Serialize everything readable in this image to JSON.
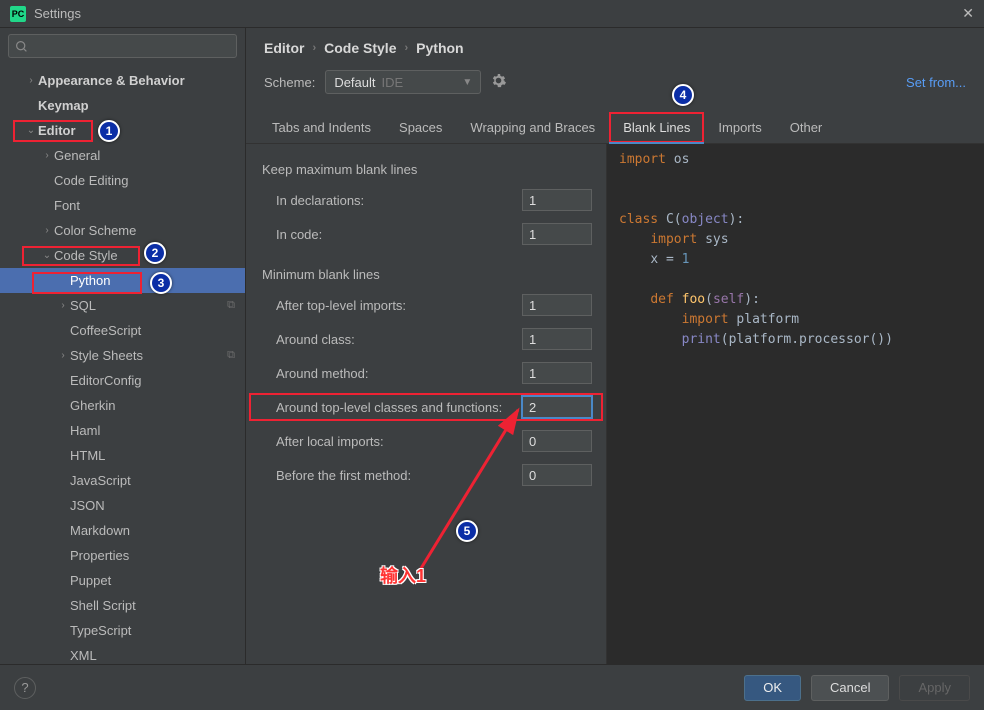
{
  "titlebar": {
    "title": "Settings"
  },
  "sidebar": {
    "search_placeholder": "",
    "items": [
      {
        "label": "Appearance & Behavior",
        "indent": 24,
        "arrow": ">",
        "bold": true
      },
      {
        "label": "Keymap",
        "indent": 24,
        "arrow": "",
        "bold": true
      },
      {
        "label": "Editor",
        "indent": 24,
        "arrow": "v",
        "bold": true
      },
      {
        "label": "General",
        "indent": 40,
        "arrow": ">"
      },
      {
        "label": "Code Editing",
        "indent": 40,
        "arrow": ""
      },
      {
        "label": "Font",
        "indent": 40,
        "arrow": ""
      },
      {
        "label": "Color Scheme",
        "indent": 40,
        "arrow": ">"
      },
      {
        "label": "Code Style",
        "indent": 40,
        "arrow": "v"
      },
      {
        "label": "Python",
        "indent": 56,
        "arrow": "",
        "selected": true
      },
      {
        "label": "SQL",
        "indent": 56,
        "arrow": ">",
        "copy": true
      },
      {
        "label": "CoffeeScript",
        "indent": 56,
        "arrow": ""
      },
      {
        "label": "Style Sheets",
        "indent": 56,
        "arrow": ">",
        "copy": true
      },
      {
        "label": "EditorConfig",
        "indent": 56,
        "arrow": ""
      },
      {
        "label": "Gherkin",
        "indent": 56,
        "arrow": ""
      },
      {
        "label": "Haml",
        "indent": 56,
        "arrow": ""
      },
      {
        "label": "HTML",
        "indent": 56,
        "arrow": ""
      },
      {
        "label": "JavaScript",
        "indent": 56,
        "arrow": ""
      },
      {
        "label": "JSON",
        "indent": 56,
        "arrow": ""
      },
      {
        "label": "Markdown",
        "indent": 56,
        "arrow": ""
      },
      {
        "label": "Properties",
        "indent": 56,
        "arrow": ""
      },
      {
        "label": "Puppet",
        "indent": 56,
        "arrow": ""
      },
      {
        "label": "Shell Script",
        "indent": 56,
        "arrow": ""
      },
      {
        "label": "TypeScript",
        "indent": 56,
        "arrow": ""
      },
      {
        "label": "XML",
        "indent": 56,
        "arrow": ""
      }
    ]
  },
  "breadcrumb": {
    "a": "Editor",
    "b": "Code Style",
    "c": "Python"
  },
  "scheme": {
    "label": "Scheme:",
    "value": "Default",
    "ide": "IDE",
    "set_from": "Set from..."
  },
  "tabs": [
    "Tabs and Indents",
    "Spaces",
    "Wrapping and Braces",
    "Blank Lines",
    "Imports",
    "Other"
  ],
  "form": {
    "sec1": "Keep maximum blank lines",
    "r1": {
      "label": "In declarations:",
      "val": "1"
    },
    "r2": {
      "label": "In code:",
      "val": "1"
    },
    "sec2": "Minimum blank lines",
    "r3": {
      "label": "After top-level imports:",
      "val": "1"
    },
    "r4": {
      "label": "Around class:",
      "val": "1"
    },
    "r5": {
      "label": "Around method:",
      "val": "1"
    },
    "r6": {
      "label": "Around top-level classes and functions:",
      "val": "2"
    },
    "r7": {
      "label": "After local imports:",
      "val": "0"
    },
    "r8": {
      "label": "Before the first method:",
      "val": "0"
    }
  },
  "preview": {
    "l1a": "import",
    "l1b": " os",
    "l2a": "class",
    "l2b": " C(",
    "l2c": "object",
    "l2d": "):",
    "l3a": "import",
    "l3b": " sys",
    "l4a": "x = ",
    "l4b": "1",
    "l5a": "def ",
    "l5b": "foo",
    "l5c": "(",
    "l5d": "self",
    "l5e": "):",
    "l6a": "import",
    "l6b": " platform",
    "l7a": "print",
    "l7b": "(platform.processor())"
  },
  "footer": {
    "ok": "OK",
    "cancel": "Cancel",
    "apply": "Apply"
  },
  "annotations": {
    "input_hint": "输入1"
  }
}
